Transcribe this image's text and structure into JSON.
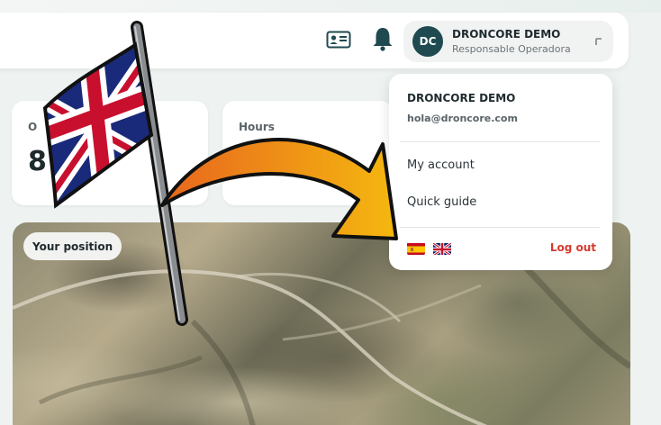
{
  "header": {
    "user_initials": "DC",
    "user_name": "DRONCORE DEMO",
    "user_role": "Responsable Operadora",
    "icons": [
      "id-card-icon",
      "bell-icon",
      "chevron-icon"
    ]
  },
  "cards": [
    {
      "title": "O",
      "value": "8"
    },
    {
      "title": "Hours",
      "value": ""
    }
  ],
  "map": {
    "position_label": "Your position"
  },
  "dropdown": {
    "name": "DRONCORE DEMO",
    "email": "hola@droncore.com",
    "items": [
      "My account",
      "Quick guide"
    ],
    "languages": [
      "spanish-flag-icon",
      "uk-flag-icon"
    ],
    "logout_label": "Log out"
  },
  "colors": {
    "accent": "#1f4a50",
    "logout": "#d63a2f",
    "arrow_start": "#e8661e",
    "arrow_end": "#f5b80f"
  }
}
